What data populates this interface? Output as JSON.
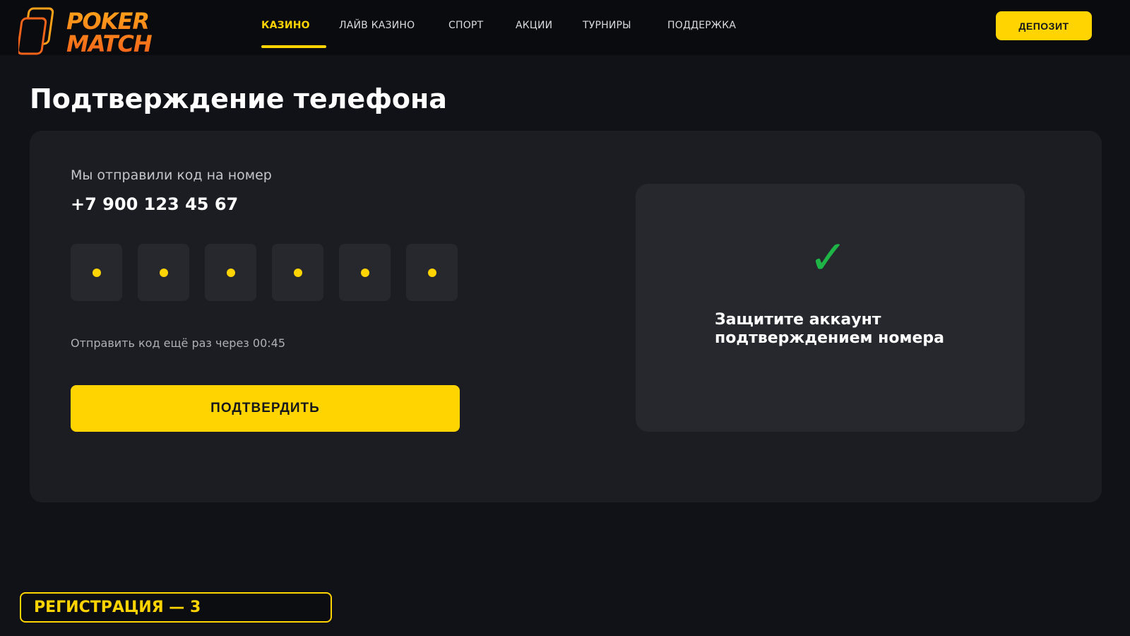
{
  "brand": {
    "logo_line1": "POKER",
    "logo_line2": "MATCH",
    "accent_color": "#ffd400",
    "logo_gradient": [
      "#ffa21a",
      "#f4631a"
    ]
  },
  "header": {
    "nav": [
      {
        "label": "КАЗИНО",
        "active": true
      },
      {
        "label": "ЛАЙВ КАЗИНО",
        "active": false
      },
      {
        "label": "СПОРТ",
        "active": false
      },
      {
        "label": "АКЦИИ",
        "active": false
      },
      {
        "label": "ТУРНИРЫ",
        "active": false
      },
      {
        "label": "ПОДДЕРЖКА",
        "active": false
      }
    ],
    "deposit_label": "ДЕПОЗИТ"
  },
  "page": {
    "title": "Подтверждение телефона"
  },
  "verification": {
    "sent_label": "Мы отправили код на номер",
    "phone_number": "+7 900 123 45 67",
    "code_digits": [
      "•",
      "•",
      "•",
      "•",
      "•",
      "•"
    ],
    "resend_text": "Отправить код ещё раз через 00:45",
    "confirm_label": "ПОДТВЕРДИТЬ"
  },
  "info": {
    "icon": "check-icon",
    "check_glyph": "✓",
    "text": "Защитите аккаунт подтверждением номера"
  },
  "footer_badge": {
    "label": "РЕГИСТРАЦИЯ — 3"
  }
}
